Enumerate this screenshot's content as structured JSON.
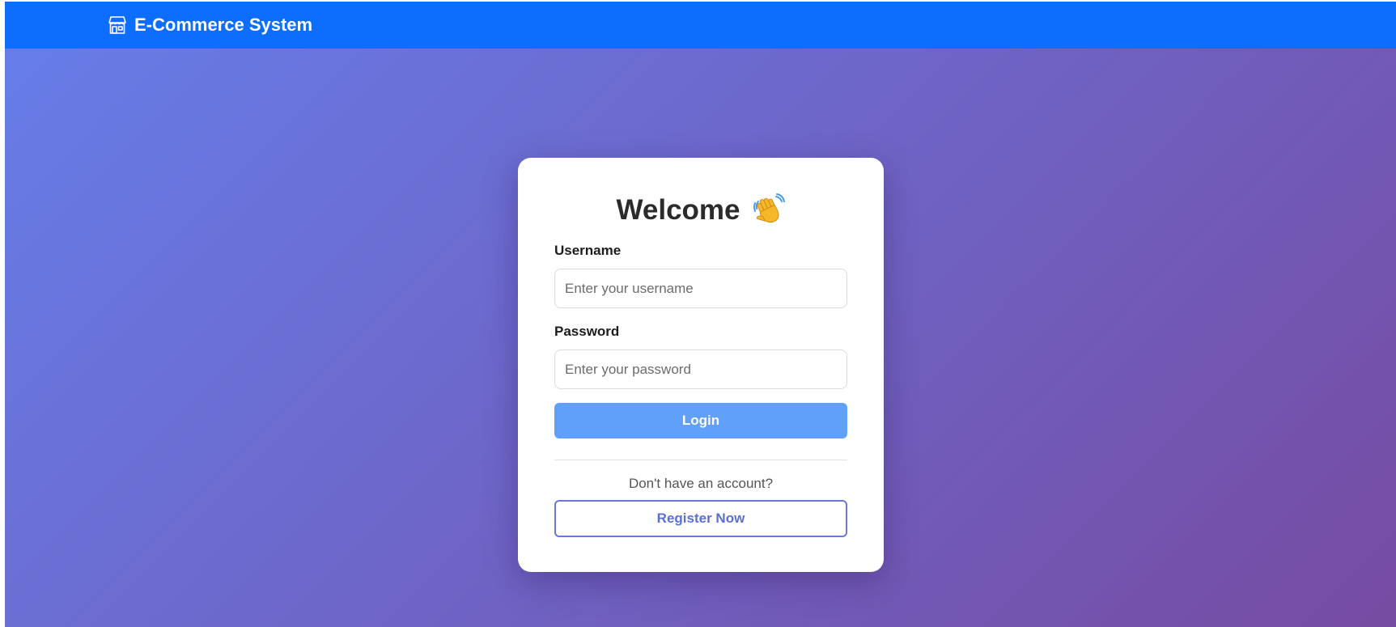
{
  "navbar": {
    "brand_icon": "shop-icon",
    "brand_text": "E-Commerce System",
    "background_color": "#0d6efd"
  },
  "background": {
    "gradient_start": "#667eea",
    "gradient_end": "#764ba2"
  },
  "login_card": {
    "title": "Welcome",
    "title_icon": "waving-hand-icon",
    "username": {
      "label": "Username",
      "placeholder": "Enter your username",
      "value": ""
    },
    "password": {
      "label": "Password",
      "placeholder": "Enter your password",
      "value": ""
    },
    "login_button": {
      "label": "Login",
      "color": "#60a0fb"
    },
    "register_prompt": "Don't have an account?",
    "register_button": {
      "label": "Register Now",
      "color": "#5c6fd6"
    }
  }
}
